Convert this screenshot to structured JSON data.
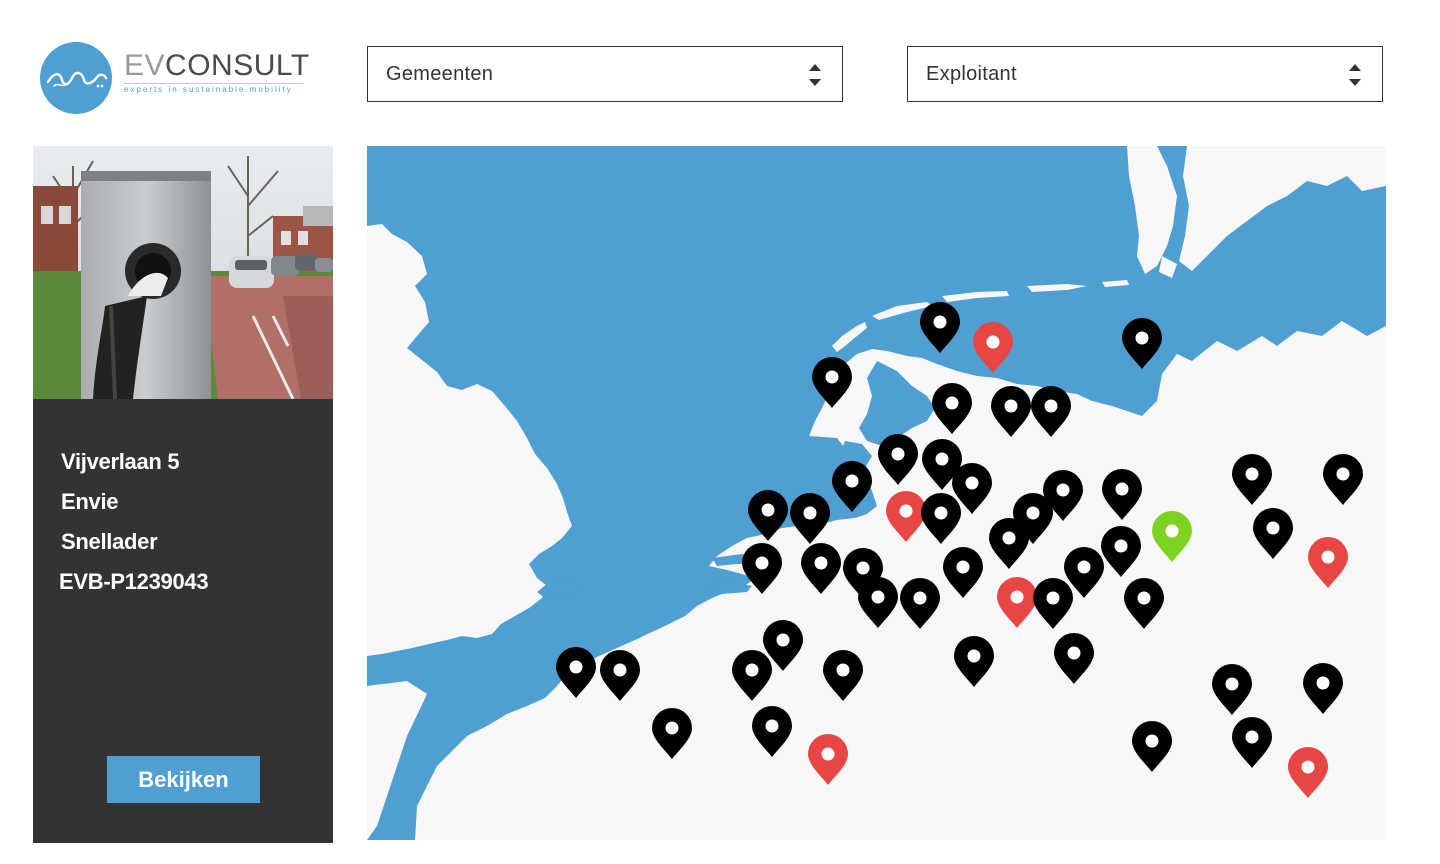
{
  "logo": {
    "ev": "EV",
    "consult": "CONSULT",
    "tagline": "experts in sustainable mobility"
  },
  "filters": {
    "municipality_label": "Gemeenten",
    "operator_label": "Exploitant"
  },
  "station": {
    "address": "Vijverlaan 5",
    "operator": "Envie",
    "charger_type": "Snellader",
    "id": "EVB-P1239043",
    "view_button": "Bekijken"
  },
  "colors": {
    "brand_blue": "#4f9fd3",
    "card_bg": "#333333",
    "pin_default": "#000000",
    "pin_red": "#e84545",
    "pin_green": "#7ed321",
    "land": "#f7f7f7"
  },
  "map": {
    "icon": "map-pin-icon"
  }
}
